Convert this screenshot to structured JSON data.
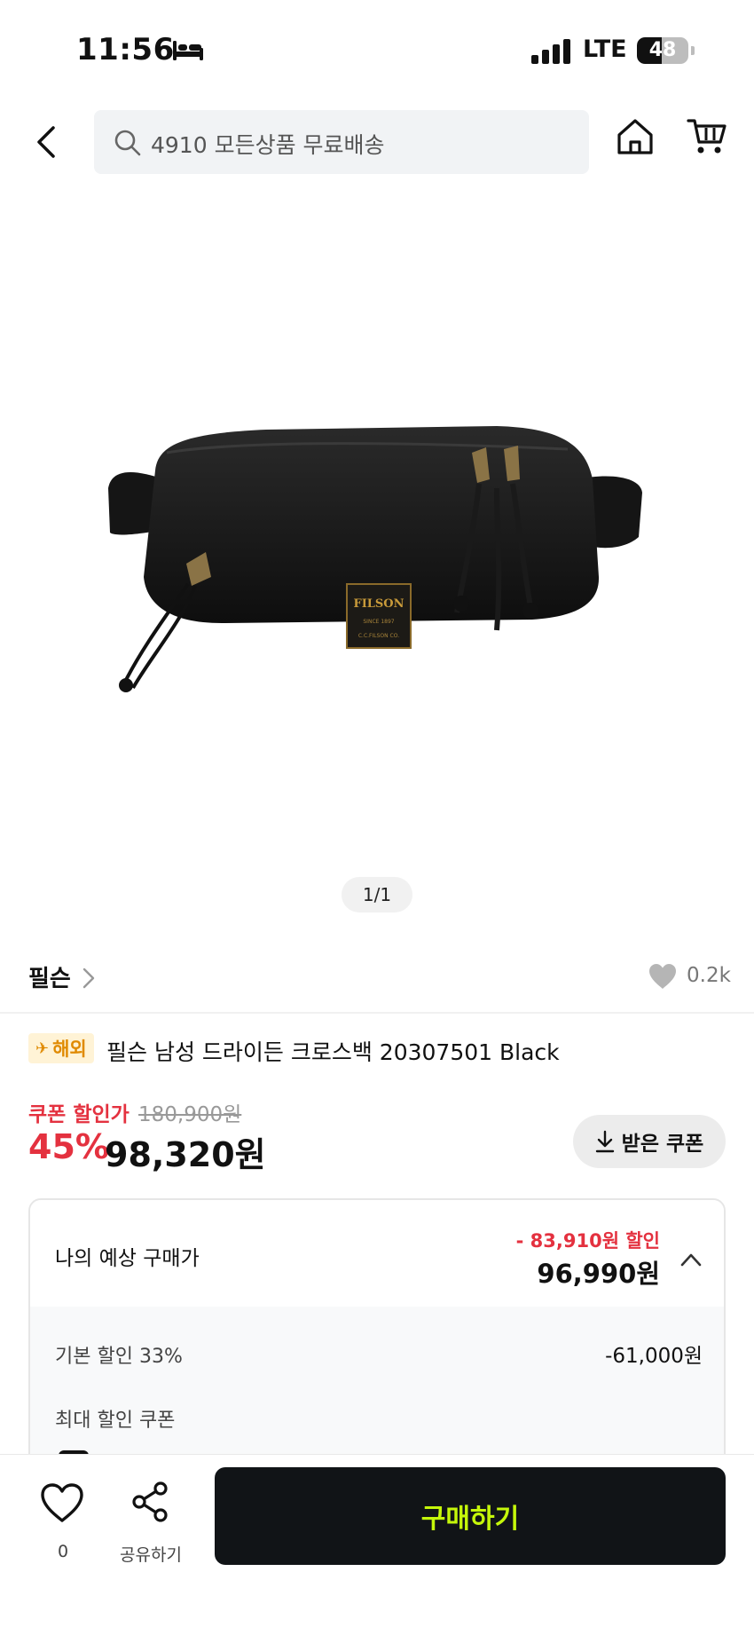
{
  "status_bar": {
    "time": "11:56",
    "network": "LTE",
    "battery_percent": 48,
    "battery_text": "48"
  },
  "top_nav": {
    "search_placeholder": "4910 모든상품 무료배송"
  },
  "product": {
    "image_counter": "1/1",
    "brand": "필슨",
    "like_count": "0.2k",
    "badge_label": "해외",
    "title": "필슨 남성 드라이든 크로스백 20307501 Black",
    "coupon_label": "쿠폰 할인가",
    "original_price": "180,900원",
    "discount_rate": "45%",
    "final_price": "98,320원",
    "coupon_button_label": "받은 쿠폰"
  },
  "expected_price": {
    "label": "나의 예상 구매가",
    "saving": "- 83,910원 할인",
    "price": "96,990원",
    "basic_discount_label": "기본 할인 33%",
    "basic_discount_value": "-61,000원",
    "max_coupon_label": "최대 할인 쿠폰"
  },
  "bottom_bar": {
    "wish_count": "0",
    "share_label": "공유하기",
    "buy_label": "구매하기"
  },
  "colors": {
    "accent_red": "#e4313f",
    "buy_button_bg": "#111417",
    "buy_button_text": "#c5f70a",
    "badge_bg": "#fff3d6",
    "badge_text": "#e08a00"
  }
}
